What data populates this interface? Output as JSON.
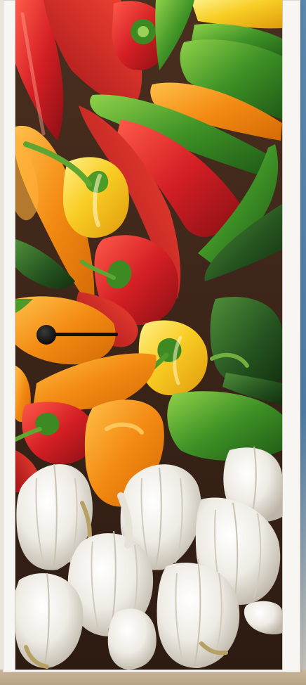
{
  "scene": {
    "subject": "door-mural",
    "icons": {
      "handle": "door-handle-icon"
    },
    "colors": {
      "wall": "#ece8e2",
      "blue_wall": "#4d7aa1",
      "floor": "#c0aa8c",
      "frame": "#f7f6f3",
      "pepper_red": "#c8202a",
      "pepper_orange": "#f08a12",
      "pepper_yellow": "#f5c21b",
      "pepper_green": "#3e8a22",
      "garlic": "#f1efe9"
    }
  }
}
